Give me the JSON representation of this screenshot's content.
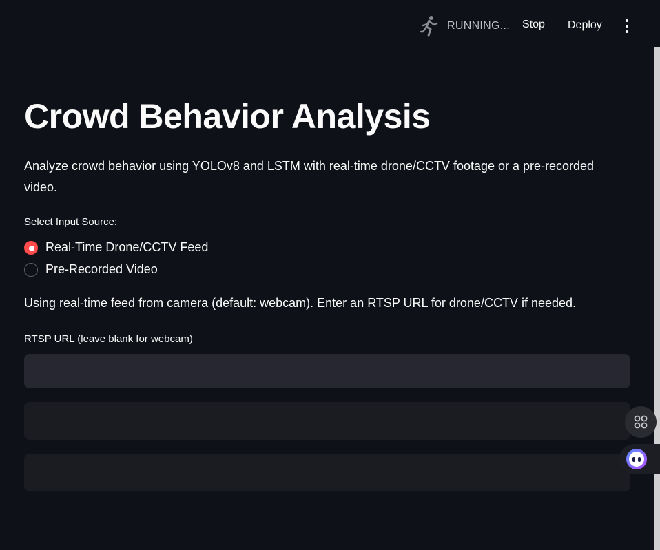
{
  "toolbar": {
    "status_text": "RUNNING...",
    "stop_label": "Stop",
    "deploy_label": "Deploy"
  },
  "main": {
    "title": "Crowd Behavior Analysis",
    "description": "Analyze crowd behavior using YOLOv8 and LSTM with real-time drone/CCTV footage or a pre-recorded video.",
    "input_source": {
      "label": "Select Input Source:",
      "options": [
        {
          "label": "Real-Time Drone/CCTV Feed",
          "selected": true
        },
        {
          "label": "Pre-Recorded Video",
          "selected": false
        }
      ]
    },
    "info_text": "Using real-time feed from camera (default: webcam). Enter an RTSP URL for drone/CCTV if needed.",
    "rtsp": {
      "label": "RTSP URL (leave blank for webcam)",
      "value": "",
      "placeholder": ""
    }
  },
  "colors": {
    "background": "#0e1117",
    "accent": "#ff4b4b",
    "input_bg": "#262730"
  },
  "icons": {
    "status": "running-person-icon",
    "menu": "vertical-ellipsis-icon",
    "grid": "command-grid-icon",
    "assistant": "assistant-bot-icon"
  }
}
